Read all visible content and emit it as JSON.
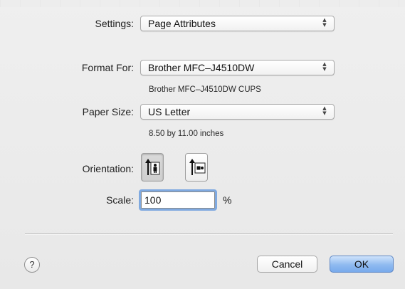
{
  "settings": {
    "label": "Settings:",
    "value": "Page Attributes"
  },
  "format_for": {
    "label": "Format For:",
    "value": "Brother MFC–J4510DW",
    "description": "Brother MFC–J4510DW CUPS"
  },
  "paper_size": {
    "label": "Paper Size:",
    "value": "US Letter",
    "description": "8.50 by 11.00 inches"
  },
  "orientation": {
    "label": "Orientation:",
    "options": [
      "portrait",
      "landscape"
    ],
    "selected": "portrait"
  },
  "scale": {
    "label": "Scale:",
    "value": "100",
    "unit": "%"
  },
  "footer": {
    "help_symbol": "?",
    "cancel_label": "Cancel",
    "ok_label": "OK"
  },
  "icons": {
    "popup_arrows": "updown-chevron-icon",
    "portrait": "portrait-orientation-icon",
    "landscape": "landscape-orientation-icon",
    "help": "help-icon"
  },
  "colors": {
    "focus_ring": "#7fa9e0",
    "default_button": "#8fbaf0"
  }
}
